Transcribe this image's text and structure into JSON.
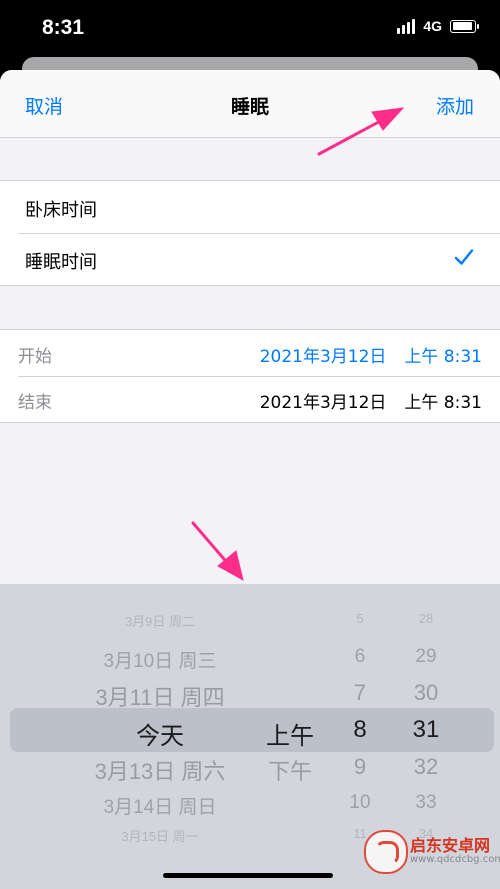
{
  "status_bar": {
    "time": "8:31",
    "network": "4G"
  },
  "nav": {
    "cancel_label": "取消",
    "title": "睡眠",
    "add_label": "添加"
  },
  "category_options": [
    {
      "label": "卧床时间",
      "selected": false
    },
    {
      "label": "睡眠时间",
      "selected": true
    }
  ],
  "dates": {
    "start": {
      "label": "开始",
      "date": "2021年3月12日",
      "time": "上午 8:31",
      "active": true
    },
    "end": {
      "label": "结束",
      "date": "2021年3月12日",
      "time": "上午 8:31",
      "active": false
    }
  },
  "picker": {
    "day_column": [
      "3月9日 周二",
      "3月10日 周三",
      "3月11日 周四",
      "今天",
      "3月13日 周六",
      "3月14日 周日",
      "3月15日 周一"
    ],
    "ampm_column": [
      "上午",
      "下午"
    ],
    "hour_column": [
      "5",
      "6",
      "7",
      "8",
      "9",
      "10",
      "11"
    ],
    "minute_column": [
      "28",
      "29",
      "30",
      "31",
      "32",
      "33",
      "34"
    ],
    "selected": {
      "day": "今天",
      "ampm": "上午",
      "hour": "8",
      "minute": "31"
    }
  },
  "watermark": {
    "name": "启东安卓网",
    "url": "www.qdcdcbg.com"
  },
  "colors": {
    "accent": "#007aff",
    "annotation_arrow": "#ff2d8a",
    "picker_bg": "#d2d5db"
  }
}
